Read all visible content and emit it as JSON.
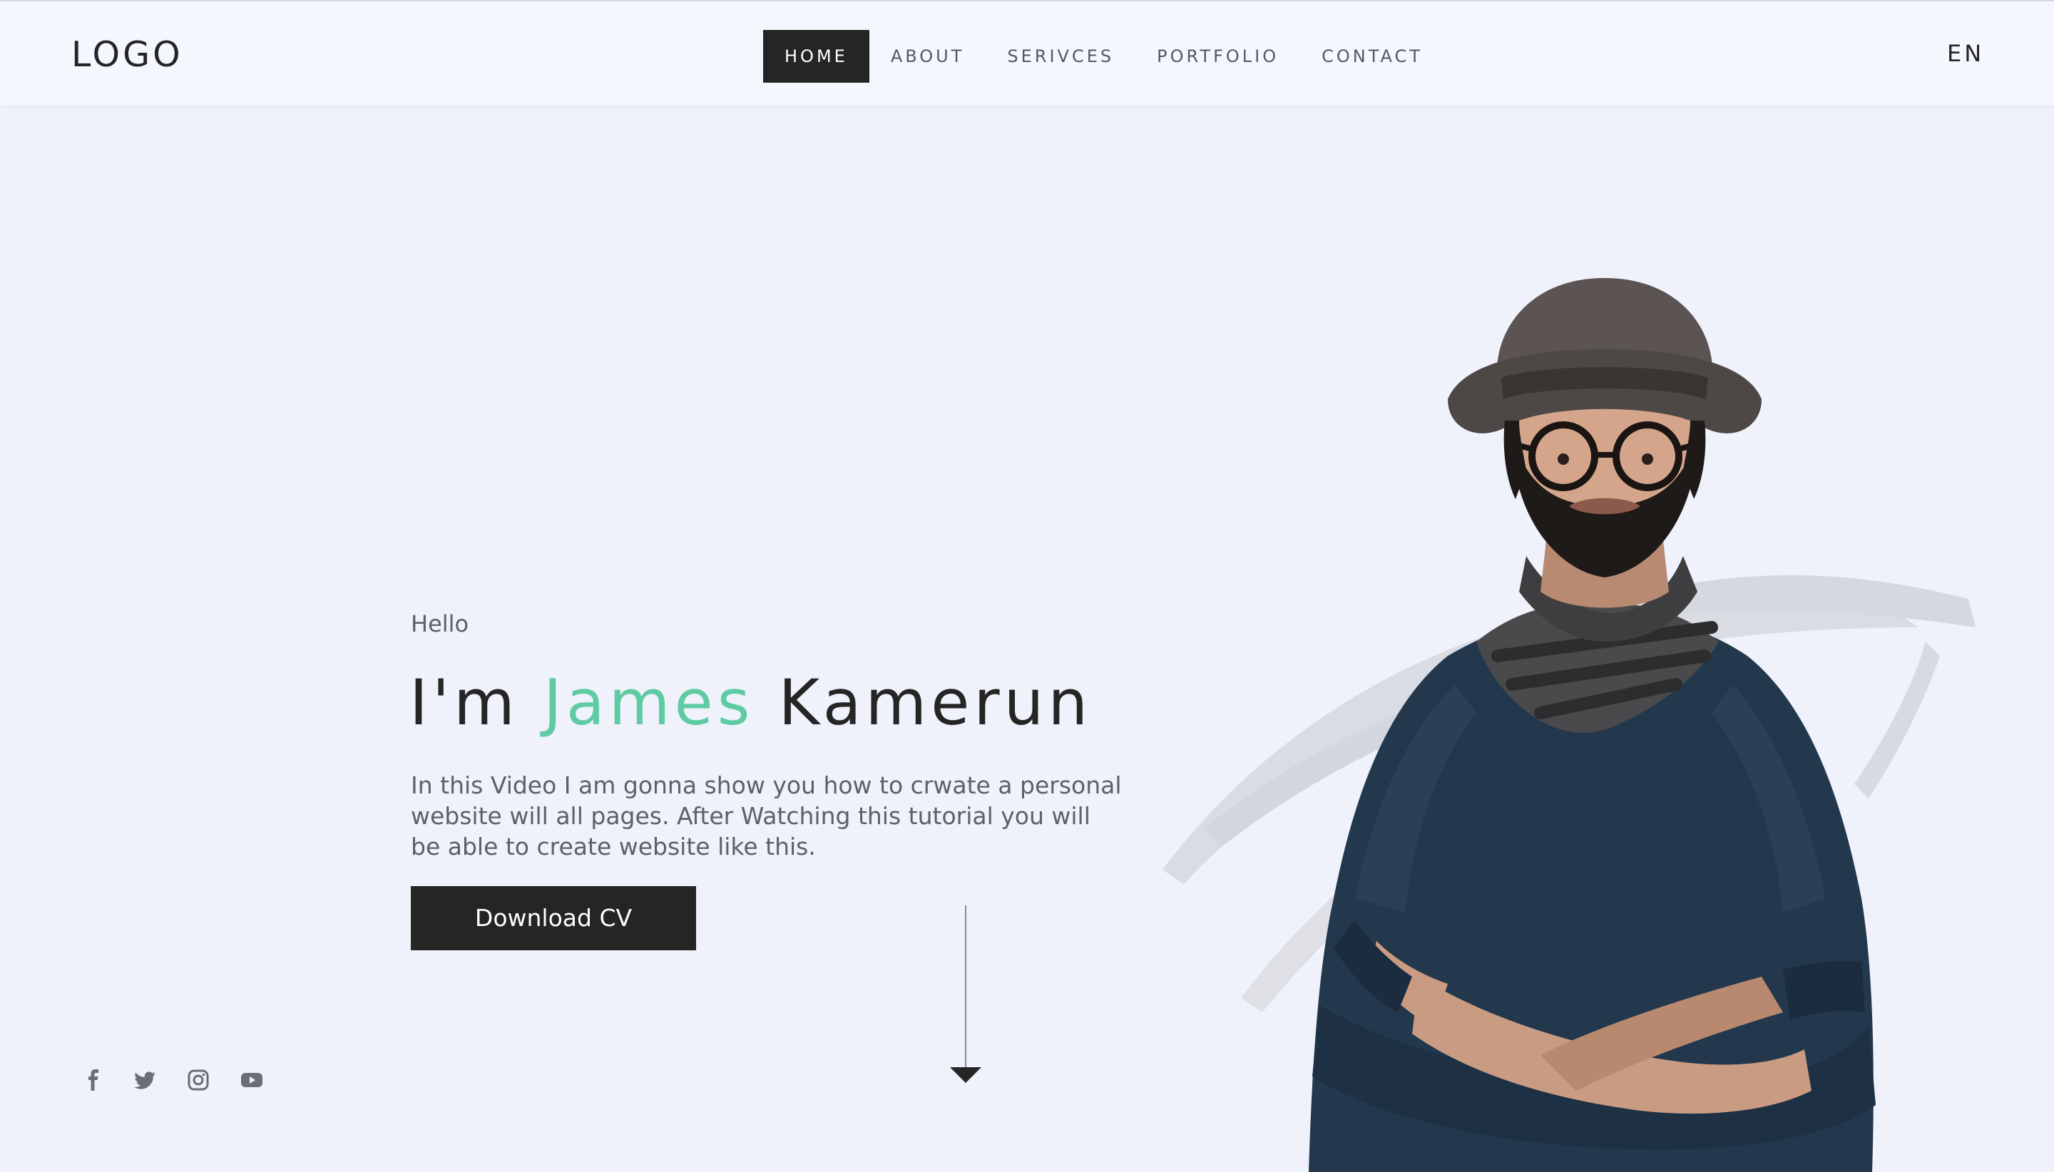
{
  "header": {
    "logo": "LOGO",
    "nav": [
      {
        "label": "HOME",
        "active": true
      },
      {
        "label": "ABOUT",
        "active": false
      },
      {
        "label": "SERIVCES",
        "active": false
      },
      {
        "label": "PORTFOLIO",
        "active": false
      },
      {
        "label": "CONTACT",
        "active": false
      }
    ],
    "language": "EN"
  },
  "hero": {
    "greeting": "Hello",
    "headline_prefix": "I'm",
    "headline_accent": "James",
    "headline_suffix": "Kamerun",
    "description": "In this Video I am gonna show you how to crwate a personal website will all pages. After Watching this tutorial you will be able to create website like this.",
    "download_button": "Download CV"
  },
  "social": [
    "facebook-icon",
    "twitter-icon",
    "instagram-icon",
    "youtube-icon"
  ],
  "colors": {
    "accent": "#5fcba2",
    "dark": "#252525",
    "background": "#eff1fb",
    "header_bg": "#f5f7fe",
    "muted_text": "#5d6068"
  }
}
